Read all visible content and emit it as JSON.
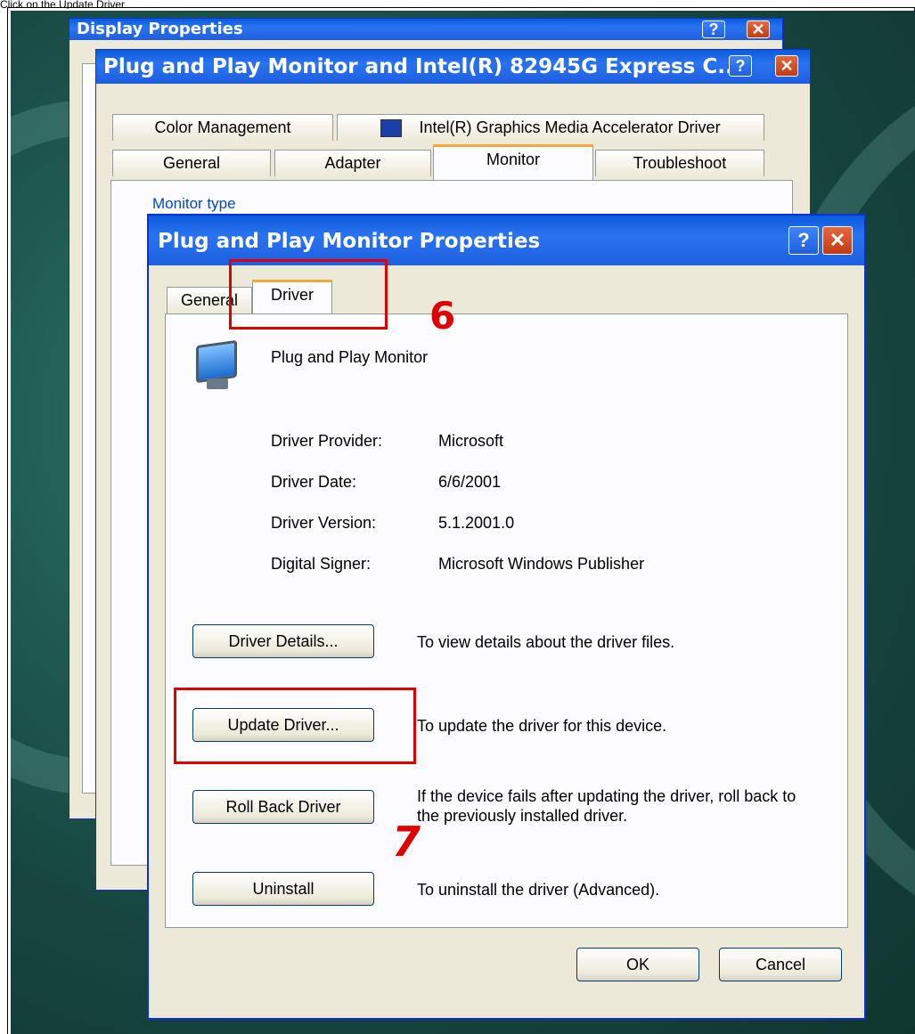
{
  "page_header": "Click on the Update Driver",
  "windows": {
    "display_properties": {
      "title": "Display Properties"
    },
    "monitor_adapter": {
      "title": "Plug and Play Monitor and Intel(R) 82945G Express C...",
      "tabs_row1": [
        "Color Management",
        "Intel(R) Graphics Media Accelerator Driver"
      ],
      "tabs_row2": [
        "General",
        "Adapter",
        "Monitor",
        "Troubleshoot"
      ],
      "selected_tab": "Monitor",
      "group_label": "Monitor type"
    },
    "monitor_properties": {
      "title": "Plug and Play Monitor Properties",
      "tabs": [
        "General",
        "Driver"
      ],
      "selected_tab": "Driver",
      "device_name": "Plug and Play Monitor",
      "info": [
        {
          "label": "Driver Provider:",
          "value": "Microsoft"
        },
        {
          "label": "Driver Date:",
          "value": "6/6/2001"
        },
        {
          "label": "Driver Version:",
          "value": "5.1.2001.0"
        },
        {
          "label": "Digital Signer:",
          "value": "Microsoft Windows Publisher"
        }
      ],
      "actions": [
        {
          "button": "Driver Details...",
          "description": "To view details about the driver files."
        },
        {
          "button": "Update Driver...",
          "description": "To update the driver for this device."
        },
        {
          "button": "Roll Back Driver",
          "description": "If the device fails after updating the driver, roll back to the previously installed driver."
        },
        {
          "button": "Uninstall",
          "description": "To uninstall the driver (Advanced)."
        }
      ],
      "ok_label": "OK",
      "cancel_label": "Cancel"
    }
  },
  "annotations": {
    "step6": "6",
    "step7": "7"
  },
  "colors": {
    "titlebar": "#0a5bde",
    "annotation": "#e00000",
    "dialog_bg": "#ece9d8"
  }
}
